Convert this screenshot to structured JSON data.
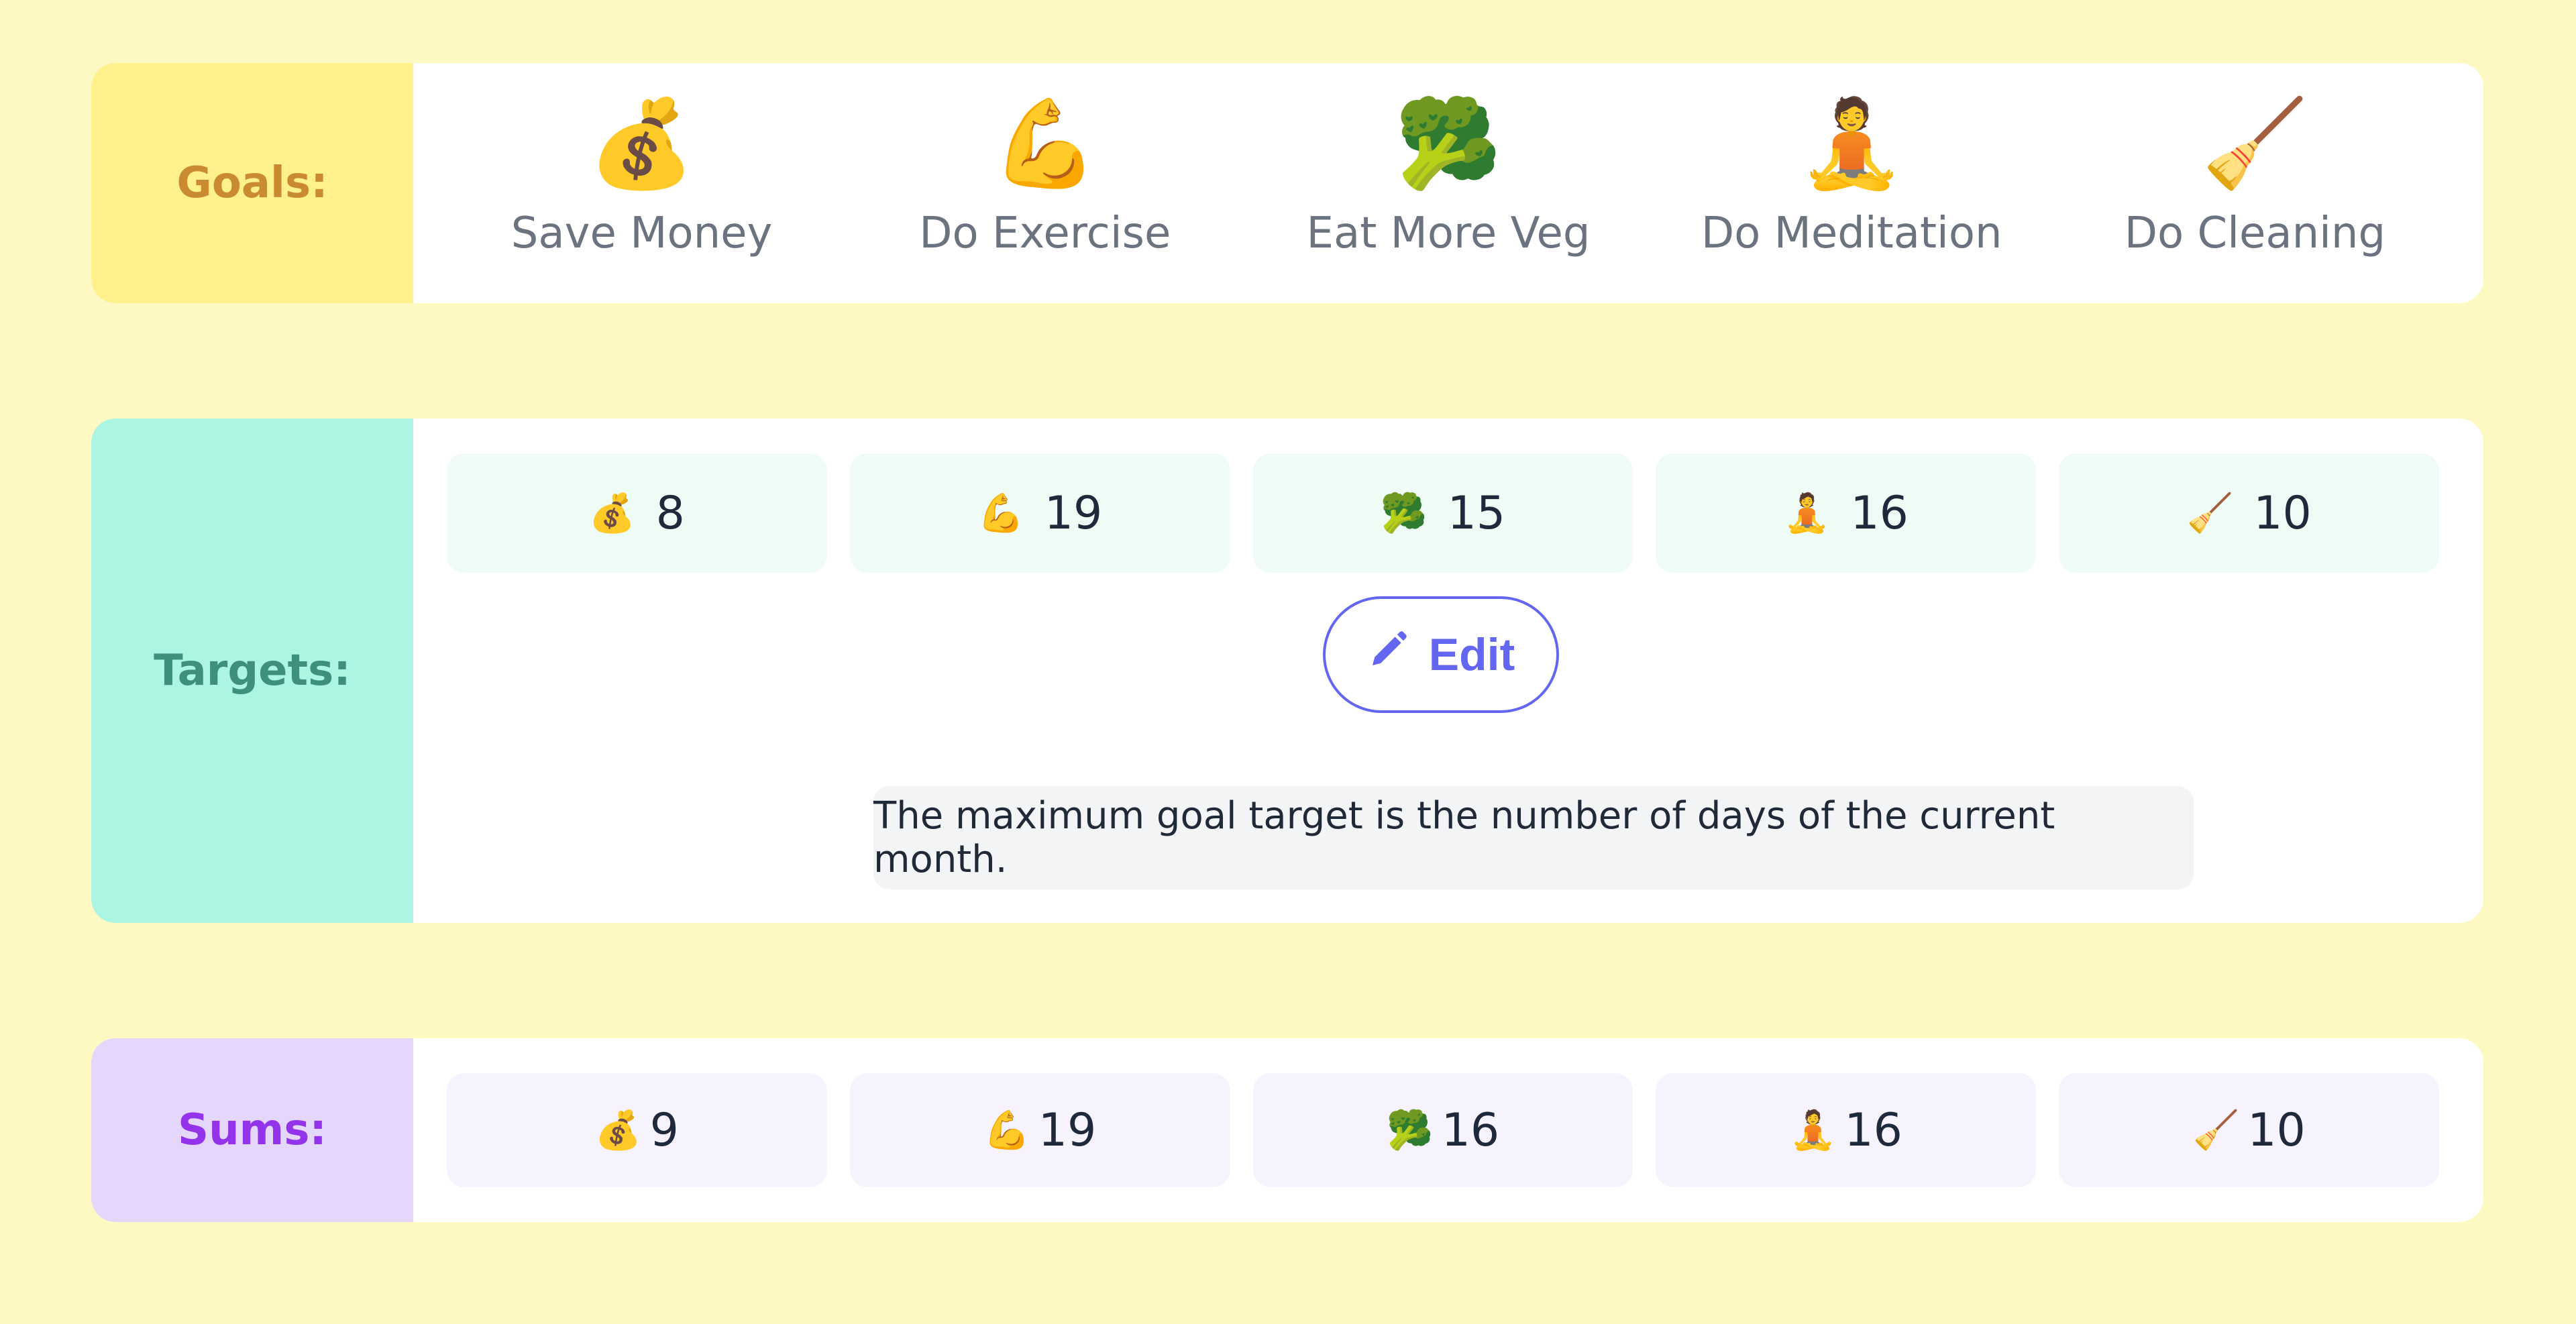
{
  "goals": {
    "label": "Goals:",
    "items": [
      {
        "icon": "money-bag-icon",
        "emoji": "💰",
        "name": "Save Money"
      },
      {
        "icon": "flexed-biceps-icon",
        "emoji": "💪",
        "name": "Do Exercise"
      },
      {
        "icon": "broccoli-icon",
        "emoji": "🥦",
        "name": "Eat More Veg"
      },
      {
        "icon": "meditation-icon",
        "emoji": "🧘",
        "name": "Do Meditation"
      },
      {
        "icon": "broom-icon",
        "emoji": "🧹",
        "name": "Do Cleaning"
      }
    ]
  },
  "targets": {
    "label": "Targets:",
    "items": [
      {
        "emoji": "💰",
        "value": "8"
      },
      {
        "emoji": "💪",
        "value": "19"
      },
      {
        "emoji": "🥦",
        "value": "15"
      },
      {
        "emoji": "🧘",
        "value": "16"
      },
      {
        "emoji": "🧹",
        "value": "10"
      }
    ],
    "edit_label": "Edit",
    "note": "The maximum goal target is the number of days of the current month."
  },
  "sums": {
    "label": "Sums:",
    "items": [
      {
        "emoji": "💰",
        "value": "9"
      },
      {
        "emoji": "💪",
        "value": "19"
      },
      {
        "emoji": "🥦",
        "value": "16"
      },
      {
        "emoji": "🧘",
        "value": "16"
      },
      {
        "emoji": "🧹",
        "value": "10"
      }
    ]
  },
  "colors": {
    "background": "#fef9c3",
    "accent": "#6366f1",
    "goals_label": "#ca8a2f",
    "targets_label": "#3f8f7f",
    "sums_label": "#9333ea"
  }
}
